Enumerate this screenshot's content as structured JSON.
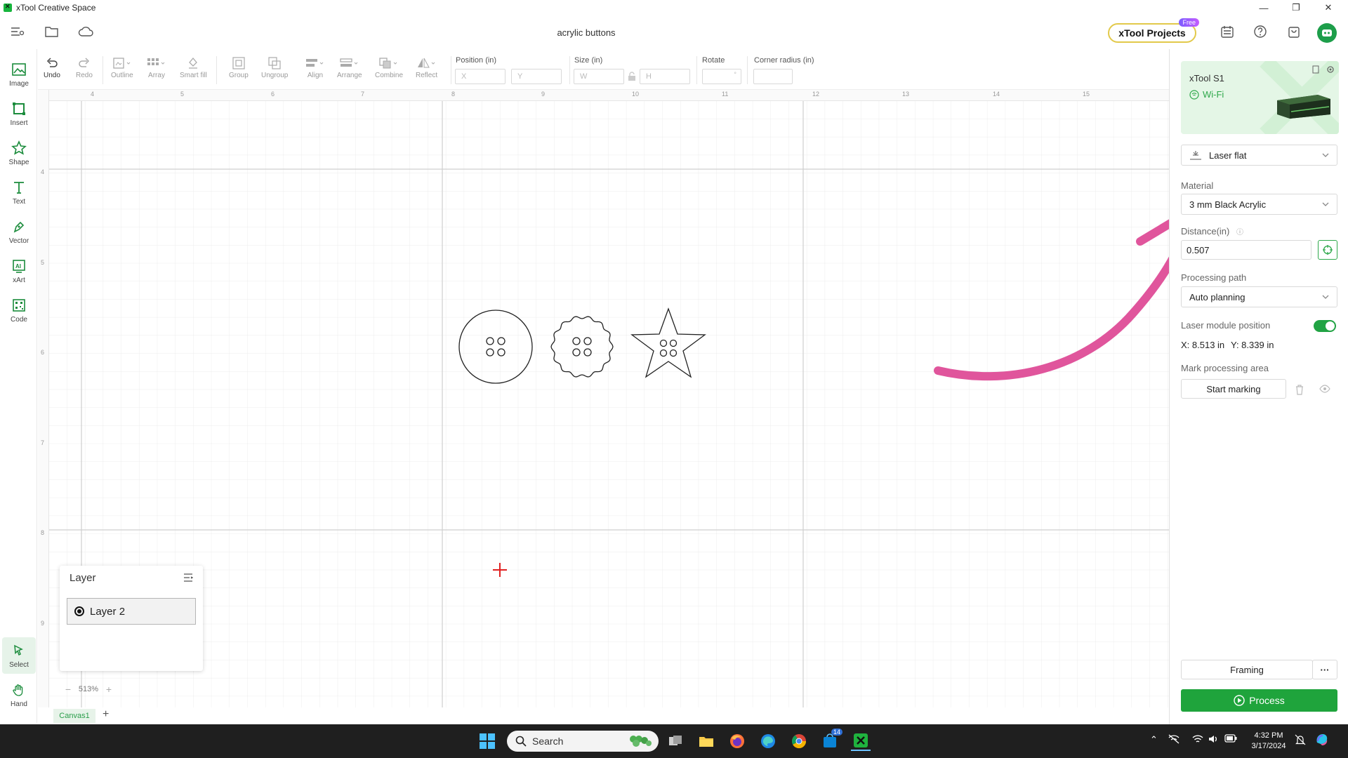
{
  "window": {
    "app_title": "xTool Creative Space",
    "minimize": "—",
    "maximize": "❐",
    "close": "✕"
  },
  "header": {
    "doc_title": "acrylic buttons",
    "projects_label": "xTool Projects",
    "projects_badge": "Free"
  },
  "left_tools": [
    {
      "label": "Image",
      "icon": "image-icon"
    },
    {
      "label": "Insert",
      "icon": "insert-icon"
    },
    {
      "label": "Shape",
      "icon": "shape-icon"
    },
    {
      "label": "Text",
      "icon": "text-icon"
    },
    {
      "label": "Vector",
      "icon": "pen-icon"
    },
    {
      "label": "xArt",
      "icon": "ai-art-icon"
    },
    {
      "label": "Code",
      "icon": "qr-code-icon"
    }
  ],
  "bottom_tools": [
    {
      "label": "Select",
      "icon": "select-arrow-icon",
      "active": true
    },
    {
      "label": "Hand",
      "icon": "hand-icon"
    }
  ],
  "toolbar": {
    "undo": "Undo",
    "redo": "Redo",
    "outline": "Outline",
    "array": "Array",
    "smart_fill": "Smart fill",
    "group": "Group",
    "ungroup": "Ungroup",
    "align": "Align",
    "arrange": "Arrange",
    "combine": "Combine",
    "reflect": "Reflect",
    "position_label": "Position (in)",
    "x_placeholder": "X",
    "y_placeholder": "Y",
    "size_label": "Size (in)",
    "w_placeholder": "W",
    "h_placeholder": "H",
    "rotate_label": "Rotate",
    "corner_label": "Corner radius (in)"
  },
  "ruler": {
    "top": [
      "4",
      "5",
      "6",
      "7",
      "8",
      "9",
      "10",
      "11",
      "12",
      "13",
      "14",
      "15"
    ],
    "left": [
      "4",
      "5",
      "6",
      "7",
      "8",
      "9"
    ]
  },
  "layer_panel": {
    "title": "Layer",
    "layers": [
      {
        "name": "Layer 2",
        "selected": true
      }
    ]
  },
  "zoom": {
    "minus": "−",
    "value": "513%",
    "plus": "+"
  },
  "canvas_tabs": {
    "tab": "Canvas1",
    "add": "+"
  },
  "right_panel": {
    "device_name": "xTool S1",
    "connection": "Wi-Fi",
    "mode": "Laser flat",
    "material_label": "Material",
    "material_value": "3 mm Black Acrylic",
    "distance_label": "Distance(in)",
    "distance_value": "0.507",
    "path_label": "Processing path",
    "path_value": "Auto planning",
    "module_label": "Laser module position",
    "module_on": true,
    "module_x": "X: 8.513 in",
    "module_y": "Y: 8.339 in",
    "mark_label": "Mark processing area",
    "start_marking": "Start marking",
    "framing": "Framing",
    "more": "···",
    "process": "Process"
  },
  "colors": {
    "accent": "#1fa43c",
    "annotation_arrow": "#e0559c",
    "cursor_cross": "#e02020"
  },
  "taskbar": {
    "search_placeholder": "Search",
    "time": "4:32 PM",
    "date": "3/17/2024",
    "badge_count": "14"
  }
}
